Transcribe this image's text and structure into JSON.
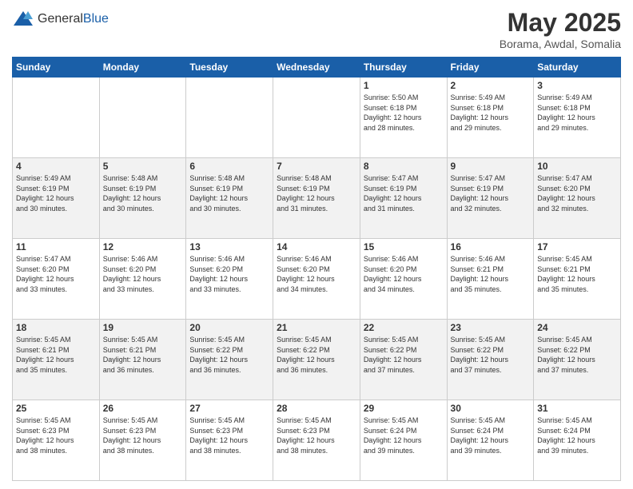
{
  "header": {
    "logo_general": "General",
    "logo_blue": "Blue",
    "month": "May 2025",
    "location": "Borama, Awdal, Somalia"
  },
  "days_of_week": [
    "Sunday",
    "Monday",
    "Tuesday",
    "Wednesday",
    "Thursday",
    "Friday",
    "Saturday"
  ],
  "weeks": [
    [
      {
        "num": "",
        "info": ""
      },
      {
        "num": "",
        "info": ""
      },
      {
        "num": "",
        "info": ""
      },
      {
        "num": "",
        "info": ""
      },
      {
        "num": "1",
        "info": "Sunrise: 5:50 AM\nSunset: 6:18 PM\nDaylight: 12 hours\nand 28 minutes."
      },
      {
        "num": "2",
        "info": "Sunrise: 5:49 AM\nSunset: 6:18 PM\nDaylight: 12 hours\nand 29 minutes."
      },
      {
        "num": "3",
        "info": "Sunrise: 5:49 AM\nSunset: 6:18 PM\nDaylight: 12 hours\nand 29 minutes."
      }
    ],
    [
      {
        "num": "4",
        "info": "Sunrise: 5:49 AM\nSunset: 6:19 PM\nDaylight: 12 hours\nand 30 minutes."
      },
      {
        "num": "5",
        "info": "Sunrise: 5:48 AM\nSunset: 6:19 PM\nDaylight: 12 hours\nand 30 minutes."
      },
      {
        "num": "6",
        "info": "Sunrise: 5:48 AM\nSunset: 6:19 PM\nDaylight: 12 hours\nand 30 minutes."
      },
      {
        "num": "7",
        "info": "Sunrise: 5:48 AM\nSunset: 6:19 PM\nDaylight: 12 hours\nand 31 minutes."
      },
      {
        "num": "8",
        "info": "Sunrise: 5:47 AM\nSunset: 6:19 PM\nDaylight: 12 hours\nand 31 minutes."
      },
      {
        "num": "9",
        "info": "Sunrise: 5:47 AM\nSunset: 6:19 PM\nDaylight: 12 hours\nand 32 minutes."
      },
      {
        "num": "10",
        "info": "Sunrise: 5:47 AM\nSunset: 6:20 PM\nDaylight: 12 hours\nand 32 minutes."
      }
    ],
    [
      {
        "num": "11",
        "info": "Sunrise: 5:47 AM\nSunset: 6:20 PM\nDaylight: 12 hours\nand 33 minutes."
      },
      {
        "num": "12",
        "info": "Sunrise: 5:46 AM\nSunset: 6:20 PM\nDaylight: 12 hours\nand 33 minutes."
      },
      {
        "num": "13",
        "info": "Sunrise: 5:46 AM\nSunset: 6:20 PM\nDaylight: 12 hours\nand 33 minutes."
      },
      {
        "num": "14",
        "info": "Sunrise: 5:46 AM\nSunset: 6:20 PM\nDaylight: 12 hours\nand 34 minutes."
      },
      {
        "num": "15",
        "info": "Sunrise: 5:46 AM\nSunset: 6:20 PM\nDaylight: 12 hours\nand 34 minutes."
      },
      {
        "num": "16",
        "info": "Sunrise: 5:46 AM\nSunset: 6:21 PM\nDaylight: 12 hours\nand 35 minutes."
      },
      {
        "num": "17",
        "info": "Sunrise: 5:45 AM\nSunset: 6:21 PM\nDaylight: 12 hours\nand 35 minutes."
      }
    ],
    [
      {
        "num": "18",
        "info": "Sunrise: 5:45 AM\nSunset: 6:21 PM\nDaylight: 12 hours\nand 35 minutes."
      },
      {
        "num": "19",
        "info": "Sunrise: 5:45 AM\nSunset: 6:21 PM\nDaylight: 12 hours\nand 36 minutes."
      },
      {
        "num": "20",
        "info": "Sunrise: 5:45 AM\nSunset: 6:22 PM\nDaylight: 12 hours\nand 36 minutes."
      },
      {
        "num": "21",
        "info": "Sunrise: 5:45 AM\nSunset: 6:22 PM\nDaylight: 12 hours\nand 36 minutes."
      },
      {
        "num": "22",
        "info": "Sunrise: 5:45 AM\nSunset: 6:22 PM\nDaylight: 12 hours\nand 37 minutes."
      },
      {
        "num": "23",
        "info": "Sunrise: 5:45 AM\nSunset: 6:22 PM\nDaylight: 12 hours\nand 37 minutes."
      },
      {
        "num": "24",
        "info": "Sunrise: 5:45 AM\nSunset: 6:22 PM\nDaylight: 12 hours\nand 37 minutes."
      }
    ],
    [
      {
        "num": "25",
        "info": "Sunrise: 5:45 AM\nSunset: 6:23 PM\nDaylight: 12 hours\nand 38 minutes."
      },
      {
        "num": "26",
        "info": "Sunrise: 5:45 AM\nSunset: 6:23 PM\nDaylight: 12 hours\nand 38 minutes."
      },
      {
        "num": "27",
        "info": "Sunrise: 5:45 AM\nSunset: 6:23 PM\nDaylight: 12 hours\nand 38 minutes."
      },
      {
        "num": "28",
        "info": "Sunrise: 5:45 AM\nSunset: 6:23 PM\nDaylight: 12 hours\nand 38 minutes."
      },
      {
        "num": "29",
        "info": "Sunrise: 5:45 AM\nSunset: 6:24 PM\nDaylight: 12 hours\nand 39 minutes."
      },
      {
        "num": "30",
        "info": "Sunrise: 5:45 AM\nSunset: 6:24 PM\nDaylight: 12 hours\nand 39 minutes."
      },
      {
        "num": "31",
        "info": "Sunrise: 5:45 AM\nSunset: 6:24 PM\nDaylight: 12 hours\nand 39 minutes."
      }
    ]
  ]
}
